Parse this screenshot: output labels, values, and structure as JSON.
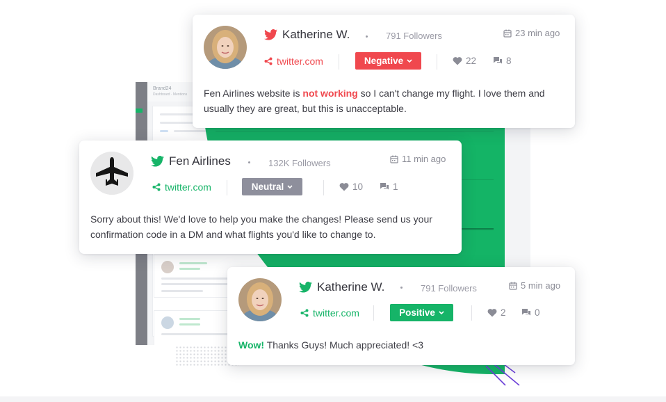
{
  "colors": {
    "brand_green": "#16b468",
    "negative_red": "#f0484e",
    "neutral_gray": "#8e8f9c",
    "text_dark": "#34343c",
    "text_muted": "#9a9aa5",
    "purple_accent": "#6b3fd8"
  },
  "background": {
    "brand_name": "Brand24",
    "brand_sub": "Dashboard · Mentions"
  },
  "cards": [
    {
      "author": "Katherine W.",
      "platform_icon": "twitter-bird-icon",
      "platform_color": "#f0484e",
      "followers": "791 Followers",
      "time": "23 min ago",
      "source": "twitter.com",
      "sentiment": "Negative",
      "sentiment_color": "#f0484e",
      "likes": "22",
      "comments": "8",
      "text_before": "Fen Airlines website is ",
      "text_highlight": "not working",
      "text_after": " so I can't change my flight. I love them and usually they are great, but this is unacceptable."
    },
    {
      "author": "Fen Airlines",
      "platform_icon": "twitter-bird-icon",
      "platform_color": "#16b468",
      "followers": "132K Followers",
      "time": "11 min ago",
      "source": "twitter.com",
      "sentiment": "Neutral",
      "sentiment_color": "#8e8f9c",
      "likes": "10",
      "comments": "1",
      "text": "Sorry about this! We'd love to help you make the changes! Please send us your confirmation code in a DM and what flights you'd like to change to."
    },
    {
      "author": "Katherine W.",
      "platform_icon": "twitter-bird-icon",
      "platform_color": "#16b468",
      "followers": "791 Followers",
      "time": "5 min ago",
      "source": "twitter.com",
      "sentiment": "Positive",
      "sentiment_color": "#16b468",
      "likes": "2",
      "comments": "0",
      "text_highlight": "Wow!",
      "text_after": " Thanks Guys! Much appreciated! <3"
    }
  ]
}
